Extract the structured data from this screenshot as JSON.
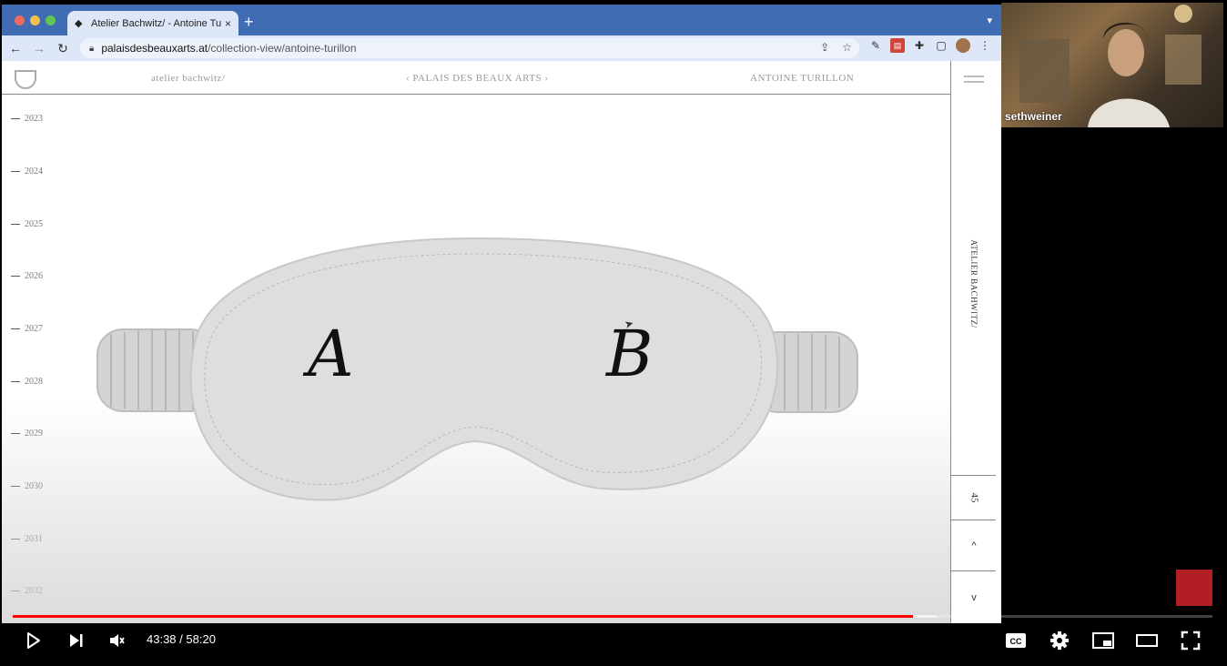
{
  "browser": {
    "tab_title": "Atelier Bachwitz/ - Antoine Tur",
    "tab_close": "×",
    "new_tab": "+",
    "url_host": "palaisdesbeauxarts.at",
    "url_path": "/collection-view/antoine-turillon"
  },
  "site": {
    "nav": {
      "left": "atelier bachwitz/",
      "center": "‹ PALAIS DES BEAUX ARTS ›",
      "right": "ANTOINE TURILLON"
    },
    "timeline": [
      "2023",
      "2024",
      "2025",
      "2026",
      "2027",
      "2028",
      "2029",
      "2030",
      "2031",
      "2032"
    ],
    "artwork": {
      "letter_left": "A",
      "letter_right": "B"
    },
    "side_panel": {
      "vertical_label": "ATELIER BACHWITZ/",
      "price": "45",
      "up": "^",
      "down": "v"
    }
  },
  "webcam": {
    "participant_name": "sethweiner"
  },
  "player": {
    "current_time": "43:38",
    "separator": " / ",
    "duration": "58:20",
    "progress_fraction": 0.75,
    "buffered_fraction": 0.77
  },
  "colors": {
    "progress": "#ff0000",
    "browser_frame": "#3f6cb3",
    "badge": "#b21e23"
  }
}
